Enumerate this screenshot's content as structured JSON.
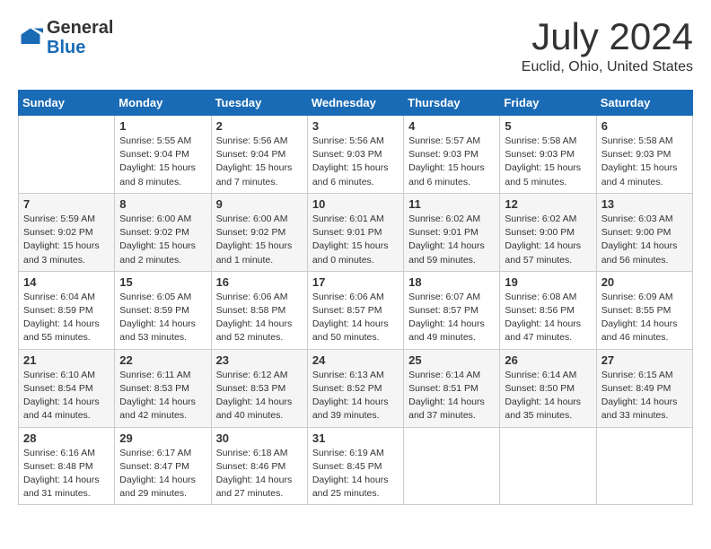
{
  "header": {
    "logo": {
      "general": "General",
      "blue": "Blue"
    },
    "title": "July 2024",
    "location": "Euclid, Ohio, United States"
  },
  "calendar": {
    "days_of_week": [
      "Sunday",
      "Monday",
      "Tuesday",
      "Wednesday",
      "Thursday",
      "Friday",
      "Saturday"
    ],
    "weeks": [
      [
        {
          "day": "",
          "info": ""
        },
        {
          "day": "1",
          "info": "Sunrise: 5:55 AM\nSunset: 9:04 PM\nDaylight: 15 hours\nand 8 minutes."
        },
        {
          "day": "2",
          "info": "Sunrise: 5:56 AM\nSunset: 9:04 PM\nDaylight: 15 hours\nand 7 minutes."
        },
        {
          "day": "3",
          "info": "Sunrise: 5:56 AM\nSunset: 9:03 PM\nDaylight: 15 hours\nand 6 minutes."
        },
        {
          "day": "4",
          "info": "Sunrise: 5:57 AM\nSunset: 9:03 PM\nDaylight: 15 hours\nand 6 minutes."
        },
        {
          "day": "5",
          "info": "Sunrise: 5:58 AM\nSunset: 9:03 PM\nDaylight: 15 hours\nand 5 minutes."
        },
        {
          "day": "6",
          "info": "Sunrise: 5:58 AM\nSunset: 9:03 PM\nDaylight: 15 hours\nand 4 minutes."
        }
      ],
      [
        {
          "day": "7",
          "info": "Sunrise: 5:59 AM\nSunset: 9:02 PM\nDaylight: 15 hours\nand 3 minutes."
        },
        {
          "day": "8",
          "info": "Sunrise: 6:00 AM\nSunset: 9:02 PM\nDaylight: 15 hours\nand 2 minutes."
        },
        {
          "day": "9",
          "info": "Sunrise: 6:00 AM\nSunset: 9:02 PM\nDaylight: 15 hours\nand 1 minute."
        },
        {
          "day": "10",
          "info": "Sunrise: 6:01 AM\nSunset: 9:01 PM\nDaylight: 15 hours\nand 0 minutes."
        },
        {
          "day": "11",
          "info": "Sunrise: 6:02 AM\nSunset: 9:01 PM\nDaylight: 14 hours\nand 59 minutes."
        },
        {
          "day": "12",
          "info": "Sunrise: 6:02 AM\nSunset: 9:00 PM\nDaylight: 14 hours\nand 57 minutes."
        },
        {
          "day": "13",
          "info": "Sunrise: 6:03 AM\nSunset: 9:00 PM\nDaylight: 14 hours\nand 56 minutes."
        }
      ],
      [
        {
          "day": "14",
          "info": "Sunrise: 6:04 AM\nSunset: 8:59 PM\nDaylight: 14 hours\nand 55 minutes."
        },
        {
          "day": "15",
          "info": "Sunrise: 6:05 AM\nSunset: 8:59 PM\nDaylight: 14 hours\nand 53 minutes."
        },
        {
          "day": "16",
          "info": "Sunrise: 6:06 AM\nSunset: 8:58 PM\nDaylight: 14 hours\nand 52 minutes."
        },
        {
          "day": "17",
          "info": "Sunrise: 6:06 AM\nSunset: 8:57 PM\nDaylight: 14 hours\nand 50 minutes."
        },
        {
          "day": "18",
          "info": "Sunrise: 6:07 AM\nSunset: 8:57 PM\nDaylight: 14 hours\nand 49 minutes."
        },
        {
          "day": "19",
          "info": "Sunrise: 6:08 AM\nSunset: 8:56 PM\nDaylight: 14 hours\nand 47 minutes."
        },
        {
          "day": "20",
          "info": "Sunrise: 6:09 AM\nSunset: 8:55 PM\nDaylight: 14 hours\nand 46 minutes."
        }
      ],
      [
        {
          "day": "21",
          "info": "Sunrise: 6:10 AM\nSunset: 8:54 PM\nDaylight: 14 hours\nand 44 minutes."
        },
        {
          "day": "22",
          "info": "Sunrise: 6:11 AM\nSunset: 8:53 PM\nDaylight: 14 hours\nand 42 minutes."
        },
        {
          "day": "23",
          "info": "Sunrise: 6:12 AM\nSunset: 8:53 PM\nDaylight: 14 hours\nand 40 minutes."
        },
        {
          "day": "24",
          "info": "Sunrise: 6:13 AM\nSunset: 8:52 PM\nDaylight: 14 hours\nand 39 minutes."
        },
        {
          "day": "25",
          "info": "Sunrise: 6:14 AM\nSunset: 8:51 PM\nDaylight: 14 hours\nand 37 minutes."
        },
        {
          "day": "26",
          "info": "Sunrise: 6:14 AM\nSunset: 8:50 PM\nDaylight: 14 hours\nand 35 minutes."
        },
        {
          "day": "27",
          "info": "Sunrise: 6:15 AM\nSunset: 8:49 PM\nDaylight: 14 hours\nand 33 minutes."
        }
      ],
      [
        {
          "day": "28",
          "info": "Sunrise: 6:16 AM\nSunset: 8:48 PM\nDaylight: 14 hours\nand 31 minutes."
        },
        {
          "day": "29",
          "info": "Sunrise: 6:17 AM\nSunset: 8:47 PM\nDaylight: 14 hours\nand 29 minutes."
        },
        {
          "day": "30",
          "info": "Sunrise: 6:18 AM\nSunset: 8:46 PM\nDaylight: 14 hours\nand 27 minutes."
        },
        {
          "day": "31",
          "info": "Sunrise: 6:19 AM\nSunset: 8:45 PM\nDaylight: 14 hours\nand 25 minutes."
        },
        {
          "day": "",
          "info": ""
        },
        {
          "day": "",
          "info": ""
        },
        {
          "day": "",
          "info": ""
        }
      ]
    ]
  }
}
